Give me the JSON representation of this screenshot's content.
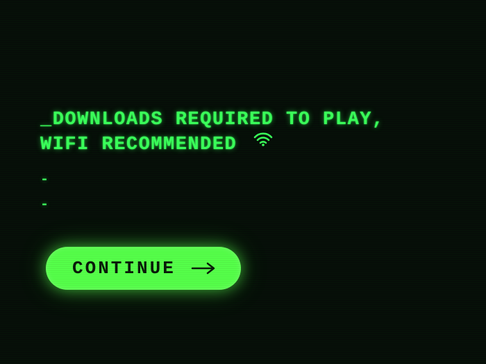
{
  "message": {
    "prefix": "_",
    "text": "DOWNLOADS REQUIRED TO PLAY, WIFI RECOMMENDED"
  },
  "loading": {
    "dash1": "-",
    "dash2": "-"
  },
  "button": {
    "label": "CONTINUE"
  },
  "colors": {
    "terminal_green": "#3aff5a",
    "button_green": "#56ff4a",
    "background": "#060d08"
  }
}
